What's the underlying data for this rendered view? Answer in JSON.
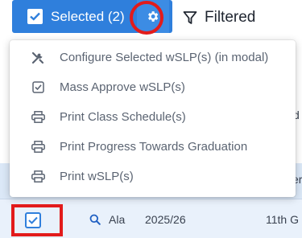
{
  "toolbar": {
    "selected_label": "Selected (2)",
    "filter_label": "Filtered",
    "accent_color": "#2f7fdc",
    "icons": [
      "checkbox-checked-icon",
      "gear-icon",
      "filter-icon"
    ]
  },
  "menu": {
    "items": [
      {
        "label": "Configure Selected wSLP(s) (in modal)",
        "icon": "tools-icon"
      },
      {
        "label": "Mass Approve wSLP(s)",
        "icon": "checkbox-icon"
      },
      {
        "label": "Print Class Schedule(s)",
        "icon": "printer-icon"
      },
      {
        "label": "Print Progress Towards Graduation",
        "icon": "printer-icon"
      },
      {
        "label": "Print wSLP(s)",
        "icon": "printer-icon"
      }
    ]
  },
  "background": {
    "edge_text_1": "r",
    "edge_text_2": "d",
    "edge_text_3": "er"
  },
  "row": {
    "name_fragment": "Ala",
    "year": "2025/26",
    "grade": "11th G"
  },
  "annotations": {
    "highlight_color": "#e21b1b"
  }
}
